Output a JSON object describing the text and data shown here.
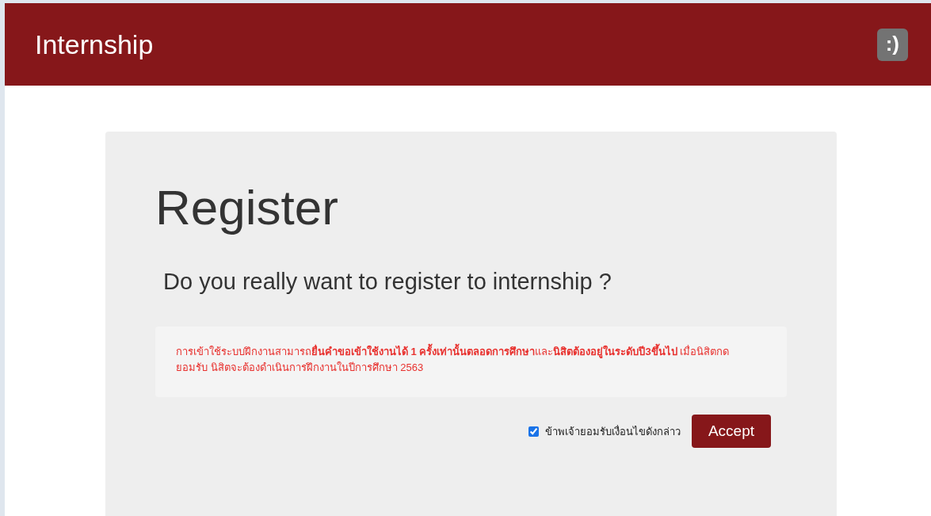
{
  "header": {
    "title": "Internship",
    "badge": ":)"
  },
  "card": {
    "title": "Register",
    "question": "Do you really want to register to internship ?",
    "notice": "การเข้าใช้ระบบฝึกงานสามารถ**ยื่นคำขอเข้าใช้งานได้ 1 ครั้งเท่านั้นตลอดการศึกษา**และ**นิสิตต้องอยู่ในระดับปี3ขึ้นไป** เมื่อนิสิตกดยอมรับ นิสิตจะต้องดำเนินการฝึกงานในปีการศึกษา 2563",
    "agree": {
      "label": "ข้าพเจ้ายอมรับเงื่อนไขดังกล่าว",
      "checked": true
    },
    "button": "Accept"
  }
}
